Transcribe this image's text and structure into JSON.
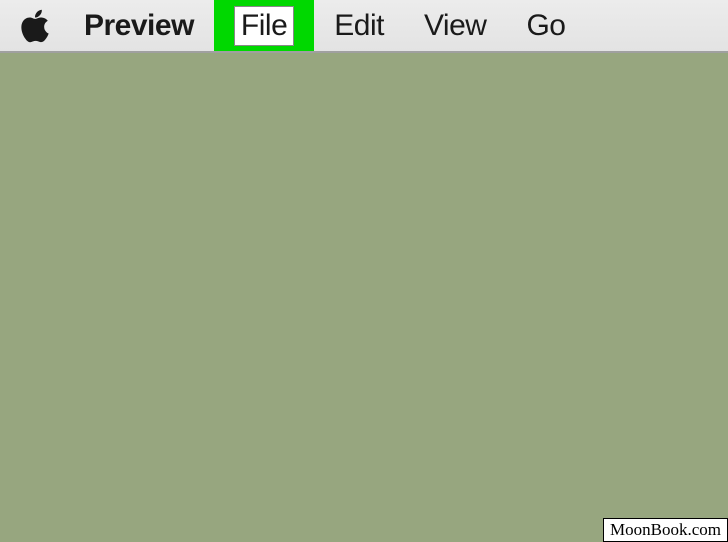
{
  "menubar": {
    "app_name": "Preview",
    "items": [
      {
        "label": "File",
        "highlighted": true
      },
      {
        "label": "Edit",
        "highlighted": false
      },
      {
        "label": "View",
        "highlighted": false
      },
      {
        "label": "Go",
        "highlighted": false
      }
    ]
  },
  "colors": {
    "desktop_bg": "#97a67f",
    "highlight": "#00d800"
  },
  "watermark": "MoonBook.com"
}
